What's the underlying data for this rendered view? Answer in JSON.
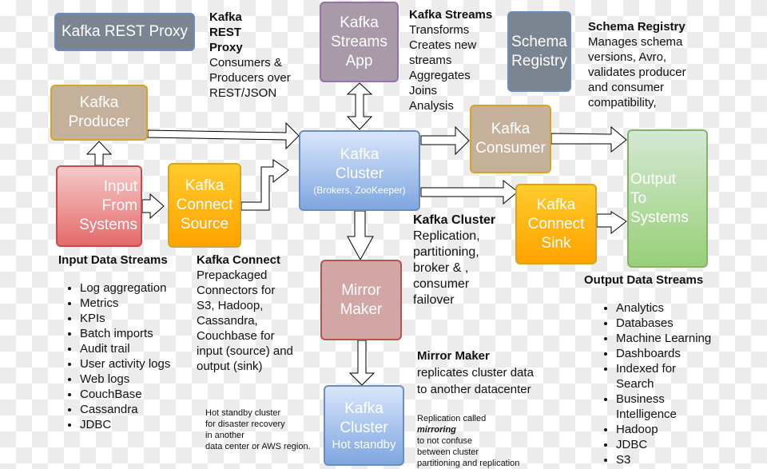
{
  "nodes": {
    "rest_proxy": {
      "label": "Kafka REST Proxy",
      "color": "#7b8491"
    },
    "producer": {
      "lines": [
        "Kafka",
        "Producer"
      ],
      "color": "#c5b19b"
    },
    "input_systems": {
      "lines": [
        "Input",
        "From",
        "Systems"
      ],
      "color": "#ea6b66"
    },
    "connect_source": {
      "lines": [
        "Kafka",
        "Connect",
        "Source"
      ],
      "color": "#ffb30f"
    },
    "streams_app": {
      "lines": [
        "Kafka",
        "Streams",
        "App"
      ],
      "color": "#a89aa9"
    },
    "cluster": {
      "lines": [
        "Kafka",
        "Cluster"
      ],
      "sub": "(Brokers, ZooKeeper)",
      "color": "#7ea6e0"
    },
    "schema_registry": {
      "lines": [
        "Schema",
        "Registry"
      ],
      "color": "#7b8491"
    },
    "consumer": {
      "lines": [
        "Kafka",
        "Consumer"
      ],
      "color": "#c5b19b"
    },
    "connect_sink": {
      "lines": [
        "Kafka",
        "Connect",
        "Sink"
      ],
      "color": "#ffb30f"
    },
    "output_systems": {
      "lines": [
        "Output",
        "To",
        "Systems"
      ],
      "color": "#97d077"
    },
    "mirror_maker": {
      "lines": [
        "Mirror",
        "Maker"
      ],
      "color": "#d3a6a6"
    },
    "standby_cluster": {
      "lines": [
        "Kafka",
        "Cluster"
      ],
      "sub": "Hot standby",
      "color": "#7ea6e0"
    }
  },
  "notes": {
    "rest_proxy": {
      "title_lines": [
        "Kafka",
        "REST",
        "Proxy"
      ],
      "body": [
        "Consumers &",
        "Producers over",
        "REST/JSON"
      ]
    },
    "streams": {
      "title": "Kafka Streams",
      "body": [
        "Transforms",
        "Creates new",
        "streams",
        "Aggregates",
        "Joins",
        "Analysis"
      ]
    },
    "schema": {
      "title": "Schema Registry",
      "body": [
        "Manages schema",
        "versions, Avro,",
        "validates producer",
        "and consumer",
        "compatibility,"
      ]
    },
    "cluster": {
      "title": "Kafka Cluster",
      "body": [
        "Replication,",
        "partitioning,",
        "broker & ,",
        "consumer",
        "failover"
      ]
    },
    "connect": {
      "title": "Kafka Connect",
      "body": [
        "Prepackaged",
        "Connectors for",
        "S3, Hadoop,",
        "Cassandra,",
        "Couchbase for",
        "input (source) and",
        "output (sink)"
      ]
    },
    "mirror": {
      "title": "Mirror Maker",
      "body": [
        "replicates cluster data",
        "to another datacenter"
      ]
    },
    "standby": {
      "body": [
        "Hot standby cluster",
        "for disaster recovery",
        "in another",
        "data center or AWS region."
      ]
    },
    "mirroring": {
      "line1": "Replication called",
      "emph": "mirroring",
      "body": [
        "to not confuse",
        "between cluster",
        "partitioning and replication"
      ]
    }
  },
  "input_streams": {
    "title": "Input Data Streams",
    "items": [
      "Log aggregation",
      "Metrics",
      "KPIs",
      "Batch imports",
      "Audit trail",
      "User activity logs",
      "Web logs",
      "CouchBase",
      "Cassandra",
      "JDBC"
    ]
  },
  "output_streams": {
    "title": "Output Data Streams",
    "items": [
      "Analytics",
      "Databases",
      "Machine Learning",
      "Dashboards",
      "Indexed for Search",
      "Business Intelligence",
      "Hadoop",
      "JDBC",
      "S3"
    ]
  }
}
